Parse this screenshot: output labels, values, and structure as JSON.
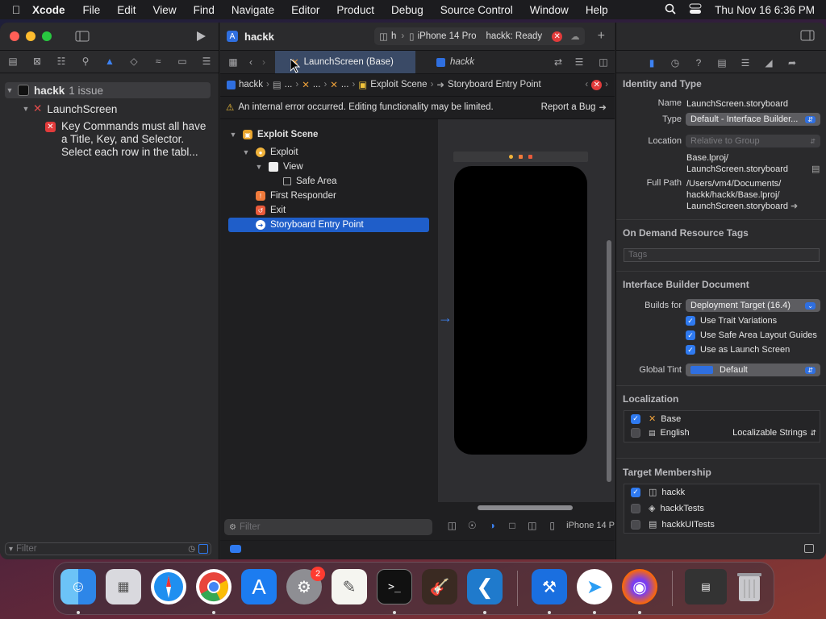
{
  "menubar": {
    "app_name": "Xcode",
    "items": [
      "File",
      "Edit",
      "View",
      "Find",
      "Navigate",
      "Editor",
      "Product",
      "Debug",
      "Source Control",
      "Window",
      "Help"
    ],
    "datetime": "Thu Nov 16  6:36 PM"
  },
  "window": {
    "project_title": "hackk",
    "scheme_short": "h",
    "destination": "iPhone 14 Pro",
    "status": "hackk: Ready"
  },
  "navigator": {
    "project": "hackk",
    "issue_count": "1 issue",
    "file": "LaunchScreen",
    "issue_line1": "Key Commands must all have",
    "issue_line2": "a Title, Key, and Selector.",
    "issue_line3": "Select each row in the tabl...",
    "filter_placeholder": "Filter"
  },
  "editor": {
    "tab_active": "LaunchScreen (Base)",
    "tab_other": "hackk",
    "breadcrumb": [
      "hackk",
      "...",
      "...",
      "...",
      "Exploit Scene",
      "Storyboard Entry Point"
    ],
    "warning": "An internal error occurred. Editing functionality may be limited.",
    "report_bug": "Report a Bug",
    "scene_tree": [
      "Exploit Scene",
      "Exploit",
      "View",
      "Safe Area",
      "First Responder",
      "Exit",
      "Storyboard Entry Point"
    ],
    "filter_placeholder": "Filter",
    "device_label": "iPhone 14 P"
  },
  "inspector": {
    "identity_title": "Identity and Type",
    "name_label": "Name",
    "name_value": "LaunchScreen.storyboard",
    "type_label": "Type",
    "type_value": "Default - Interface Builder...",
    "location_label": "Location",
    "location_value": "Relative to Group",
    "location_path1": "Base.lproj/",
    "location_path2": "LaunchScreen.storyboard",
    "fullpath_label": "Full Path",
    "fullpath1": "/Users/vm4/Documents/",
    "fullpath2": "hackk/hackk/Base.lproj/",
    "fullpath3": "LaunchScreen.storyboard",
    "odr_title": "On Demand Resource Tags",
    "tags_placeholder": "Tags",
    "ibd_title": "Interface Builder Document",
    "builds_for_label": "Builds for",
    "builds_for_value": "Deployment Target (16.4)",
    "trait": "Use Trait Variations",
    "safe_area": "Use Safe Area Layout Guides",
    "launch_screen": "Use as Launch Screen",
    "tint_label": "Global Tint",
    "tint_value": "Default",
    "localization_title": "Localization",
    "loc_base": "Base",
    "loc_english": "English",
    "loc_strings": "Localizable Strings",
    "target_title": "Target Membership",
    "targets": [
      "hackk",
      "hackkTests",
      "hackkUITests"
    ]
  },
  "dock": {
    "settings_badge": "2"
  },
  "colors": {
    "accent": "#2f7af0",
    "error": "#e23b3b",
    "selection": "#1f5ec9"
  }
}
